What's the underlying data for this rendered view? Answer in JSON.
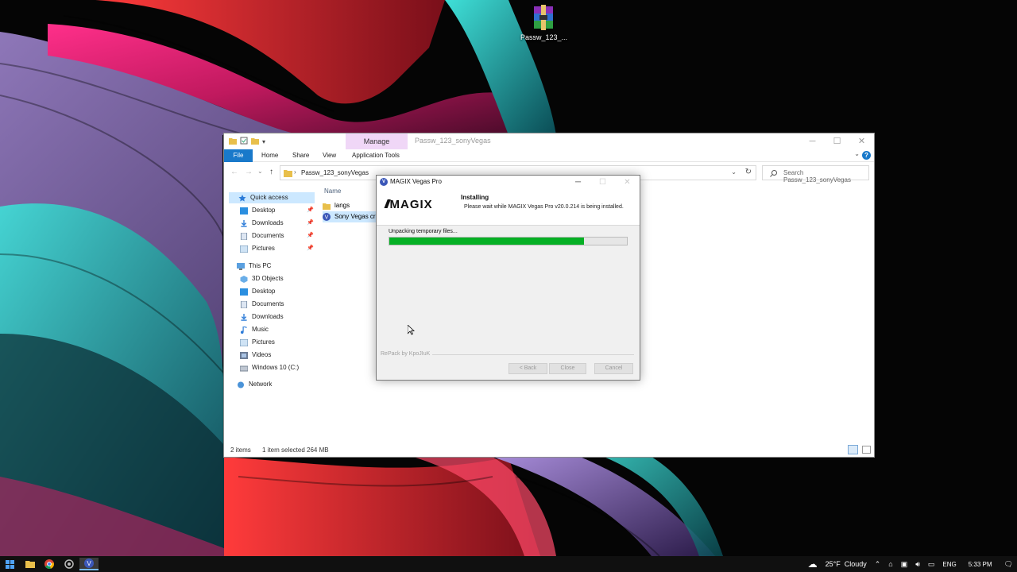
{
  "desktop": {
    "icon_label": "Passw_123_..."
  },
  "explorer": {
    "title": "Passw_123_sonyVegas",
    "manage_tab": "Manage",
    "ribbon_tabs": [
      "File",
      "Home",
      "Share",
      "View",
      "Application Tools"
    ],
    "address_path": "Passw_123_sonyVegas",
    "search_placeholder": "Search Passw_123_sonyVegas",
    "nav": {
      "quick_access": "Quick access",
      "quick_items": [
        "Desktop",
        "Downloads",
        "Documents",
        "Pictures"
      ],
      "this_pc": "This PC",
      "pc_items": [
        "3D Objects",
        "Desktop",
        "Documents",
        "Downloads",
        "Music",
        "Pictures",
        "Videos",
        "Windows 10 (C:)"
      ],
      "network": "Network"
    },
    "column_name": "Name",
    "files": [
      "langs",
      "Sony Vegas cra"
    ],
    "status": {
      "count": "2 items",
      "selected": "1 item selected",
      "size": "264 MB"
    }
  },
  "installer": {
    "title": "MAGIX Vegas Pro",
    "logo_text": "MAGIX",
    "heading": "Installing",
    "subtext": "Please wait while MAGIX Vegas Pro v20.0.214 is being installed.",
    "status": "Unpacking temporary files...",
    "progress": 0.82,
    "repack": "RePack by KpoJIuK",
    "buttons": {
      "back": "< Back",
      "close": "Close",
      "cancel": "Cancel"
    }
  },
  "taskbar": {
    "weather_temp": "25°F",
    "weather_desc": "Cloudy",
    "language": "ENG",
    "time": "5:33 PM"
  },
  "colors": {
    "progress_fill": "#06b025",
    "accent": "#1979ca",
    "manage_tab": "#f0d7f7"
  }
}
